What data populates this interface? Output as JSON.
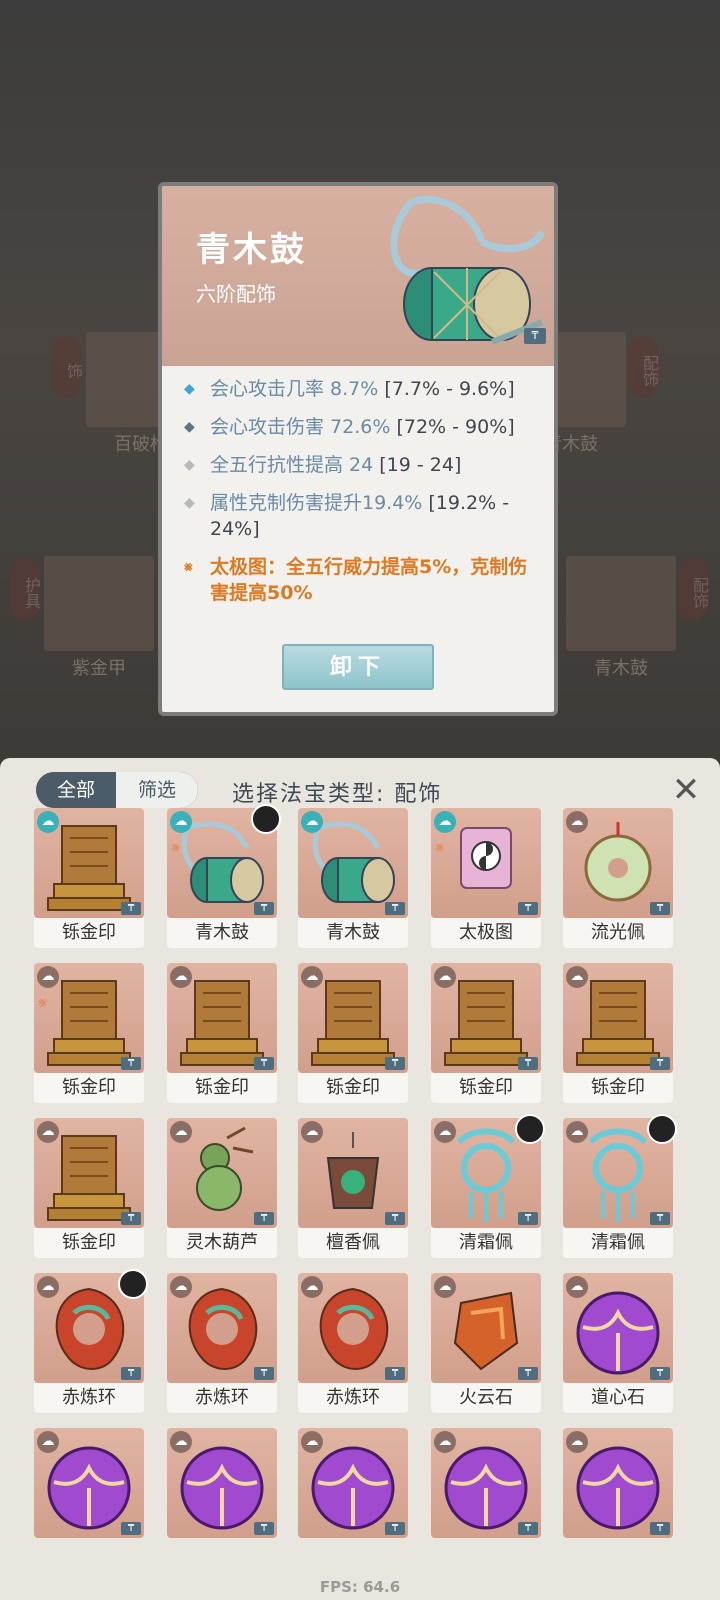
{
  "background": {
    "slots": [
      {
        "tag": "饰",
        "label": "百破枪"
      },
      {
        "tag": "配饰",
        "label": "青木鼓"
      },
      {
        "tag": "护具",
        "label": "紫金甲"
      },
      {
        "tag": "配饰",
        "label": "青木鼓"
      }
    ]
  },
  "popup": {
    "title": "青木鼓",
    "subtitle": "六阶配饰",
    "grade_mark": "₸",
    "stats": [
      {
        "bullet": "◆",
        "bullet_color": "#3fa6d8",
        "text": "会心攻击几率 8.7%",
        "range": " [7.7% - 9.6%]"
      },
      {
        "bullet": "◆",
        "bullet_color": "#5d7388",
        "text": "会心攻击伤害 72.6%",
        "range": " [72% - 90%]"
      },
      {
        "bullet": "◆",
        "bullet_color": "#b9b9b9",
        "text": "全五行抗性提高 24",
        "range": " [19 - 24]"
      },
      {
        "bullet": "◆",
        "bullet_color": "#b9b9b9",
        "text": "属性克制伤害提升19.4%",
        "range": " [19.2% - 24%]"
      }
    ],
    "special": {
      "bullet": "⨳",
      "text": "太极图：全五行威力提高5%，克制伤害提高50%"
    },
    "unequip_label": "卸下"
  },
  "panel": {
    "tab_all": "全部",
    "tab_filter": "筛选",
    "title": "选择法宝类型: 配饰",
    "close_label": "✕",
    "items": [
      {
        "name": "铄金印",
        "kind": "seal",
        "corner": "teal"
      },
      {
        "name": "青木鼓",
        "kind": "drum",
        "corner": "teal",
        "owner": true,
        "mark": true
      },
      {
        "name": "青木鼓",
        "kind": "drum",
        "corner": "teal"
      },
      {
        "name": "太极图",
        "kind": "scroll",
        "corner": "teal",
        "mark": true
      },
      {
        "name": "流光佩",
        "kind": "jade",
        "corner": "brown"
      },
      {
        "name": "铄金印",
        "kind": "seal",
        "corner": "brown",
        "mark": true
      },
      {
        "name": "铄金印",
        "kind": "seal",
        "corner": "brown"
      },
      {
        "name": "铄金印",
        "kind": "seal",
        "corner": "brown"
      },
      {
        "name": "铄金印",
        "kind": "seal",
        "corner": "brown"
      },
      {
        "name": "铄金印",
        "kind": "seal",
        "corner": "brown"
      },
      {
        "name": "铄金印",
        "kind": "seal",
        "corner": "brown"
      },
      {
        "name": "灵木葫芦",
        "kind": "gourd",
        "corner": "brown"
      },
      {
        "name": "檀香佩",
        "kind": "pouch",
        "corner": "brown"
      },
      {
        "name": "清霜佩",
        "kind": "frost",
        "corner": "brown",
        "owner": true
      },
      {
        "name": "清霜佩",
        "kind": "frost",
        "corner": "brown",
        "owner": true
      },
      {
        "name": "赤炼环",
        "kind": "ring",
        "corner": "brown",
        "owner": true
      },
      {
        "name": "赤炼环",
        "kind": "ring",
        "corner": "brown"
      },
      {
        "name": "赤炼环",
        "kind": "ring",
        "corner": "brown"
      },
      {
        "name": "火云石",
        "kind": "fire",
        "corner": "brown"
      },
      {
        "name": "道心石",
        "kind": "orb",
        "corner": "brown"
      },
      {
        "name": "",
        "kind": "orb",
        "corner": "brown"
      },
      {
        "name": "",
        "kind": "orb",
        "corner": "brown"
      },
      {
        "name": "",
        "kind": "orb",
        "corner": "brown"
      },
      {
        "name": "",
        "kind": "orb",
        "corner": "brown"
      },
      {
        "name": "",
        "kind": "orb",
        "corner": "brown"
      }
    ]
  },
  "fps": "FPS: 64.6"
}
